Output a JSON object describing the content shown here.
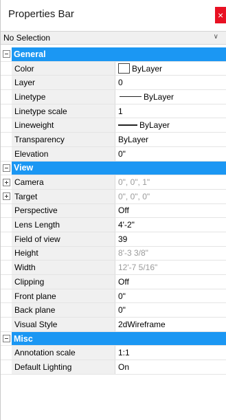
{
  "title": "Properties Bar",
  "close_glyph": "×",
  "selector": {
    "value": "No Selection",
    "chevron": "∨"
  },
  "categories": [
    {
      "name": "General",
      "rows": [
        {
          "name": "Color",
          "value": "ByLayer",
          "muted": false
        },
        {
          "name": "Layer",
          "value": "0",
          "muted": false
        },
        {
          "name": "Linetype",
          "value": "ByLayer",
          "muted": false
        },
        {
          "name": "Linetype scale",
          "value": "1",
          "muted": false
        },
        {
          "name": "Lineweight",
          "value": "ByLayer",
          "muted": false
        },
        {
          "name": "Transparency",
          "value": "ByLayer",
          "muted": false
        },
        {
          "name": "Elevation",
          "value": "0\"",
          "muted": false
        }
      ]
    },
    {
      "name": "View",
      "rows": [
        {
          "name": "Camera",
          "value": "0\", 0\", 1\"",
          "muted": true
        },
        {
          "name": "Target",
          "value": "0\", 0\", 0\"",
          "muted": true
        },
        {
          "name": "Perspective",
          "value": "Off",
          "muted": false
        },
        {
          "name": "Lens Length",
          "value": "4'-2\"",
          "muted": false
        },
        {
          "name": "Field of view",
          "value": "39",
          "muted": false
        },
        {
          "name": "Height",
          "value": "8'-3 3/8\"",
          "muted": true
        },
        {
          "name": "Width",
          "value": "12'-7 5/16\"",
          "muted": true
        },
        {
          "name": "Clipping",
          "value": "Off",
          "muted": false
        },
        {
          "name": "Front plane",
          "value": "0\"",
          "muted": false
        },
        {
          "name": "Back plane",
          "value": "0\"",
          "muted": false
        },
        {
          "name": "Visual Style",
          "value": "2dWireframe",
          "muted": false
        }
      ]
    },
    {
      "name": "Misc",
      "rows": [
        {
          "name": "Annotation scale",
          "value": "1:1",
          "muted": false
        },
        {
          "name": "Default Lighting",
          "value": "On",
          "muted": false
        }
      ]
    }
  ],
  "colors": {
    "category_bg": "#1b97f3",
    "close_bg": "#e81123",
    "name_bg": "#f0f0f0",
    "muted_text": "#9a9a9a"
  }
}
